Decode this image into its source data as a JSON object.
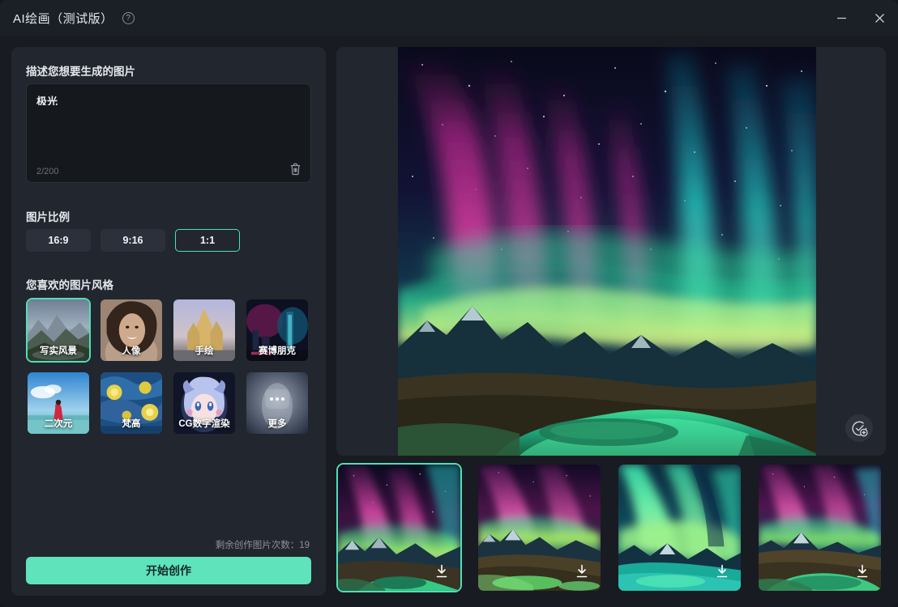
{
  "window": {
    "title": "AI绘画（测试版）",
    "help_icon": "question-circle-icon",
    "minimize_label": "−",
    "close_label": "✕"
  },
  "left_panel": {
    "prompt": {
      "label": "描述您想要生成的图片",
      "value": "极光",
      "placeholder": "描述您想要生成的图片",
      "counter": "2/200",
      "clear_icon": "trash-icon"
    },
    "ratio": {
      "label": "图片比例",
      "options": [
        {
          "label": "16:9",
          "selected": false
        },
        {
          "label": "9:16",
          "selected": false
        },
        {
          "label": "1:1",
          "selected": true
        }
      ]
    },
    "style": {
      "label": "您喜欢的图片风格",
      "items": [
        {
          "label": "写实风景",
          "selected": true
        },
        {
          "label": "人像",
          "selected": false
        },
        {
          "label": "手绘",
          "selected": false
        },
        {
          "label": "赛博朋克",
          "selected": false
        },
        {
          "label": "二次元",
          "selected": false
        },
        {
          "label": "梵高",
          "selected": false
        },
        {
          "label": "CG数字渲染",
          "selected": false
        },
        {
          "label": "更多",
          "selected": false,
          "icon": "ellipsis-icon"
        }
      ]
    },
    "remaining_text": "剩余创作图片次数：19",
    "create_button": "开始创作"
  },
  "preview": {
    "image_alt": "极光 aurora borealis over mountains",
    "add_to_track_icon": "check-circle-plus-icon"
  },
  "results": {
    "items": [
      {
        "selected": true,
        "download_icon": "download-icon"
      },
      {
        "selected": false,
        "download_icon": "download-icon"
      },
      {
        "selected": false,
        "download_icon": "download-icon"
      },
      {
        "selected": false,
        "download_icon": "download-icon"
      }
    ]
  },
  "colors": {
    "accent": "#4fe0b4",
    "button": "#5fe3bb",
    "panel": "#22262e",
    "app_bg": "#181b21",
    "titlebar": "#1b1f26",
    "input_bg": "#15181d"
  }
}
